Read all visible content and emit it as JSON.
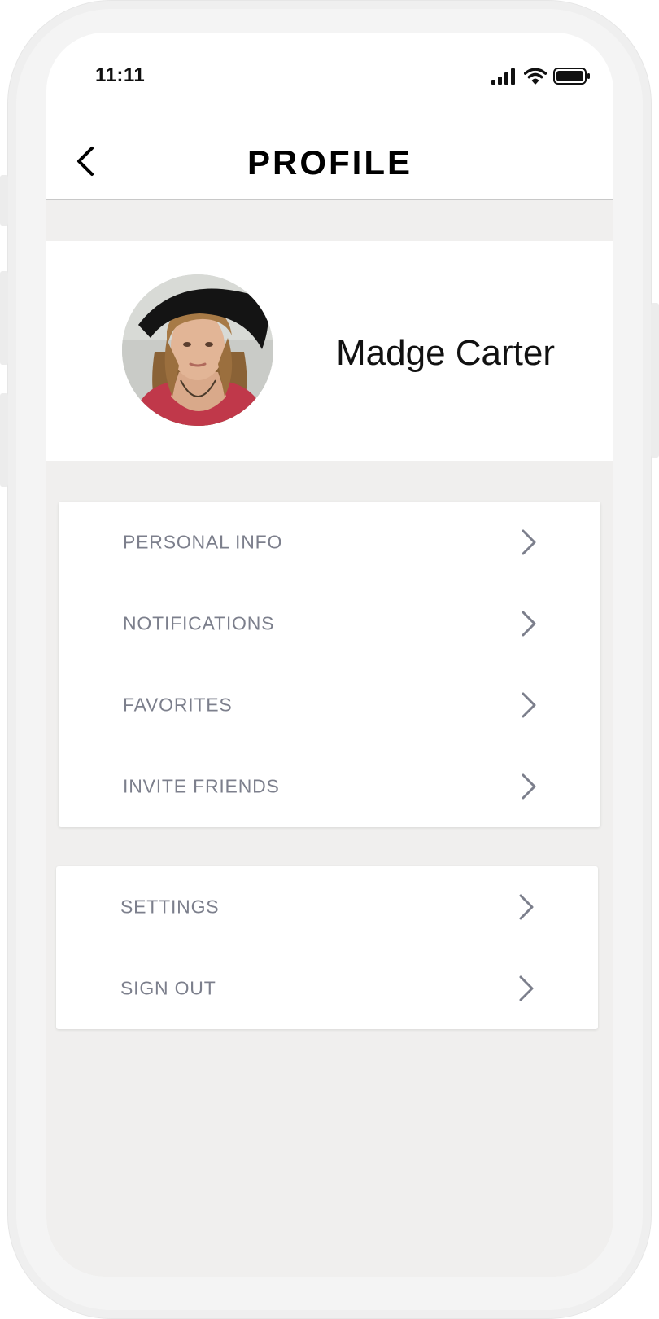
{
  "status_bar": {
    "time": "11:11"
  },
  "header": {
    "title": "PROFILE",
    "back_icon": "chevron-left-icon"
  },
  "profile": {
    "name": "Madge Carter"
  },
  "menu_primary": [
    {
      "label": "PERSONAL INFO",
      "icon": "chevron-right-icon"
    },
    {
      "label": "NOTIFICATIONS",
      "icon": "chevron-right-icon"
    },
    {
      "label": "FAVORITES",
      "icon": "chevron-right-icon"
    },
    {
      "label": "INVITE FRIENDS",
      "icon": "chevron-right-icon"
    }
  ],
  "menu_secondary": [
    {
      "label": "SETTINGS",
      "icon": "chevron-right-icon"
    },
    {
      "label": "SIGN OUT",
      "icon": "chevron-right-icon"
    }
  ],
  "colors": {
    "background": "#f0efee",
    "card": "#ffffff",
    "menu_text": "#7c7f8c",
    "title": "#000000"
  }
}
